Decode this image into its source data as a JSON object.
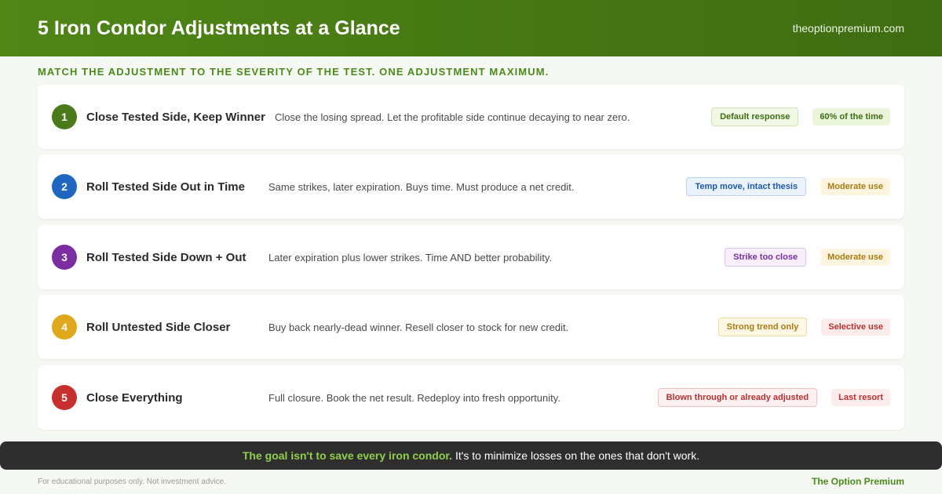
{
  "header": {
    "title": "5 Iron Condor Adjustments at a Glance",
    "site": "theoptionpremium.com"
  },
  "subtitle": "MATCH THE ADJUSTMENT TO THE SEVERITY OF THE TEST. ONE ADJUSTMENT MAXIMUM.",
  "adjustments": [
    {
      "number": "1",
      "title": "Close Tested Side, Keep Winner",
      "description": "Close the losing spread. Let the profitable side continue decaying to near zero.",
      "trigger": "Default response",
      "frequency": "60% of the time",
      "color": "#4a7a1a"
    },
    {
      "number": "2",
      "title": "Roll Tested Side Out in Time",
      "description": "Same strikes, later expiration. Buys time. Must produce a net credit.",
      "trigger": "Temp move, intact thesis",
      "frequency": "Moderate use",
      "color": "#1e66c0"
    },
    {
      "number": "3",
      "title": "Roll Tested Side Down + Out",
      "description": "Later expiration plus lower strikes. Time AND better probability.",
      "trigger": "Strike too close",
      "frequency": "Moderate use",
      "color": "#7a2ea0"
    },
    {
      "number": "4",
      "title": "Roll Untested Side Closer",
      "description": "Buy back nearly-dead winner. Resell closer to stock for new credit.",
      "trigger": "Strong trend only",
      "frequency": "Selective use",
      "color": "#e0a81a"
    },
    {
      "number": "5",
      "title": "Close Everything",
      "description": "Full closure. Book the net result. Redeploy into fresh opportunity.",
      "trigger": "Blown through or already adjusted",
      "frequency": "Last resort",
      "color": "#c83030"
    }
  ],
  "banner": {
    "strong": "The goal isn't to save every iron condor.",
    "rest": "It's to minimize losses on the ones that don't work."
  },
  "footer": {
    "disclaimer": "For educational purposes only. Not investment advice.",
    "brand": "The Option Premium"
  }
}
